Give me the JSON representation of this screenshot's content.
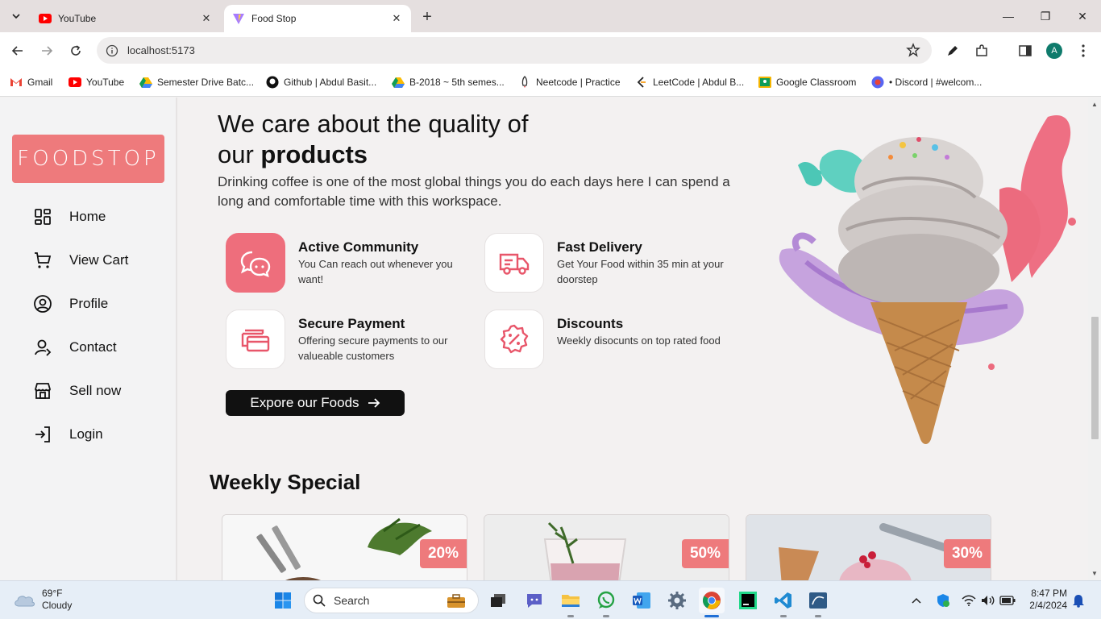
{
  "browser": {
    "tabs": [
      {
        "title": "YouTube",
        "active": false
      },
      {
        "title": "Food Stop",
        "active": true
      }
    ],
    "url": "localhost:5173",
    "profile_initial": "A",
    "bookmarks": [
      "Gmail",
      "YouTube",
      "Semester Drive Batc...",
      "Github | Abdul Basit...",
      "B-2018 ~ 5th semes...",
      "Neetcode | Practice",
      "LeetCode | Abdul B...",
      "Google Classroom",
      "• Discord | #welcom..."
    ]
  },
  "sidebar": {
    "logo": "FOODSTOP",
    "items": [
      {
        "label": "Home",
        "icon": "grid-icon"
      },
      {
        "label": "View Cart",
        "icon": "cart-icon"
      },
      {
        "label": "Profile",
        "icon": "user-circle-icon"
      },
      {
        "label": "Contact",
        "icon": "contact-icon"
      },
      {
        "label": "Sell now",
        "icon": "shop-icon"
      },
      {
        "label": "Login",
        "icon": "login-icon"
      }
    ]
  },
  "hero": {
    "headline_line1": "We care about the quality of",
    "headline_line2_prefix": "our ",
    "headline_line2_bold": "products",
    "lead": "Drinking coffee is one of the most global things you do each days here I can spend a long and comfortable time with this workspace.",
    "cta": "Expore our Foods"
  },
  "features": [
    {
      "title": "Active Community",
      "desc": "You Can reach out whenever you want!",
      "icon": "chat-icon"
    },
    {
      "title": "Fast Delivery",
      "desc": "Get Your Food within 35 min at your doorstep",
      "icon": "truck-icon"
    },
    {
      "title": "Secure Payment",
      "desc": "Offering secure payments to our valueable customers",
      "icon": "card-icon"
    },
    {
      "title": "Discounts",
      "desc": "Weekly disocunts on top rated food",
      "icon": "percent-badge-icon"
    }
  ],
  "weekly": {
    "title": "Weekly Special",
    "cards": [
      {
        "discount": "20%"
      },
      {
        "discount": "50%"
      },
      {
        "discount": "30%"
      }
    ]
  },
  "taskbar": {
    "temp": "69°F",
    "condition": "Cloudy",
    "search_placeholder": "Search",
    "time": "8:47 PM",
    "date": "2/4/2024"
  },
  "colors": {
    "accent": "#ee7a7c",
    "feature_pink": "#ee6e7c",
    "cta_bg": "#111111"
  }
}
